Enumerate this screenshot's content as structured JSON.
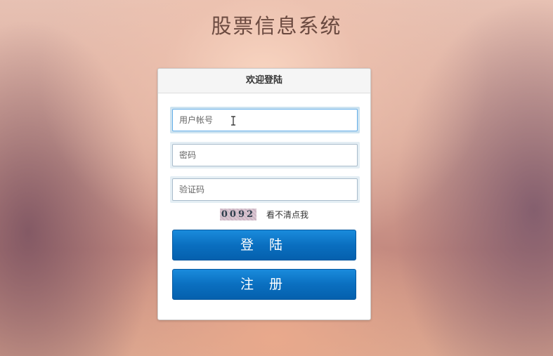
{
  "page": {
    "title": "股票信息系统"
  },
  "login_panel": {
    "header": "欢迎登陆",
    "username": {
      "placeholder": "用户帐号",
      "value": ""
    },
    "password": {
      "placeholder": "密码",
      "value": ""
    },
    "captcha": {
      "placeholder": "验证码",
      "value": "",
      "image_text": "0092",
      "refresh_label": "看不清点我"
    },
    "login_button": "登 陆",
    "register_button": "注 册"
  },
  "colors": {
    "button_primary": "#0a6fc0",
    "title_text": "#6b4a40",
    "focus_border": "#66afe9"
  }
}
